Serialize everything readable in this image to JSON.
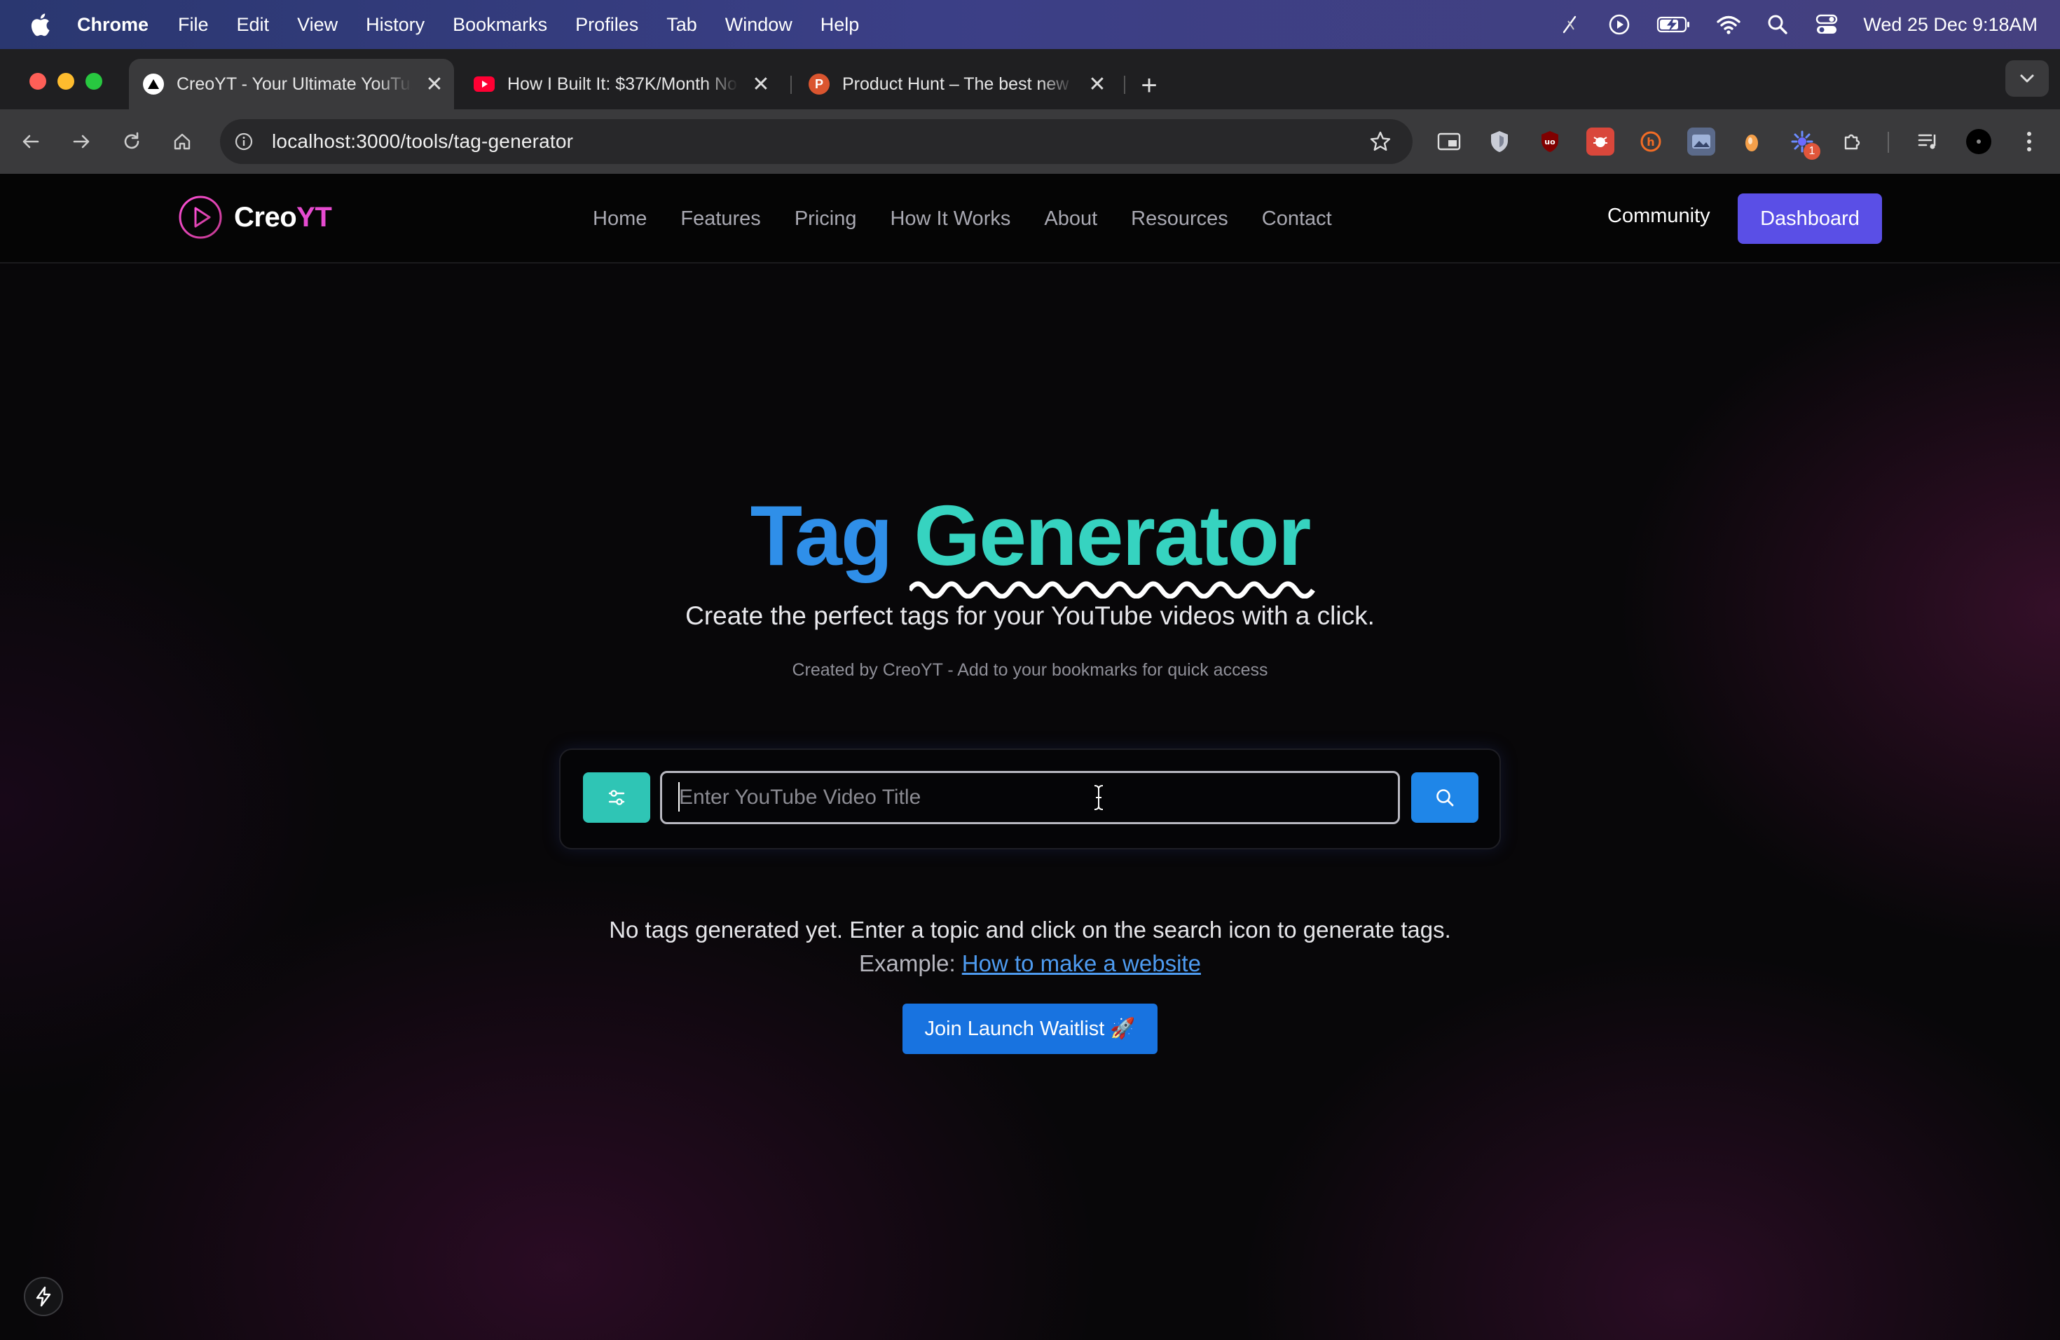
{
  "menubar": {
    "app": "Chrome",
    "items": [
      "File",
      "Edit",
      "View",
      "History",
      "Bookmarks",
      "Profiles",
      "Tab",
      "Window",
      "Help"
    ],
    "clock": "Wed 25 Dec  9:18AM",
    "icons": [
      "pen-slash-icon",
      "play-circle-icon",
      "battery-charging-icon",
      "wifi-icon",
      "spotlight-search-icon",
      "control-center-icon"
    ]
  },
  "browser": {
    "tabs": [
      {
        "title": "CreoYT - Your Ultimate YouTube",
        "icon": "triangle-favicon",
        "active": true
      },
      {
        "title": "How I Built It: $37K/Month No",
        "icon": "youtube-favicon",
        "active": false
      },
      {
        "title": "Product Hunt – The best new",
        "icon": "producthunt-favicon",
        "active": false
      }
    ],
    "new_tab": "+",
    "url": "localhost:3000/tools/tag-generator",
    "extension_badge": "1"
  },
  "site": {
    "brand_part1": "Creo",
    "brand_part2": "YT",
    "nav": [
      "Home",
      "Features",
      "Pricing",
      "How It Works",
      "About",
      "Resources",
      "Contact"
    ],
    "community": "Community",
    "dashboard": "Dashboard"
  },
  "hero": {
    "title_part1": "Tag",
    "title_part2": "Generator",
    "subtitle": "Create the perfect tags for your YouTube videos with a click.",
    "note": "Created by CreoYT - Add to your bookmarks for quick access"
  },
  "search": {
    "placeholder": "Enter YouTube Video Title",
    "value": ""
  },
  "empty_state": {
    "message": "No tags generated yet. Enter a topic and click on the search icon to generate tags.",
    "example_label": "Example: ",
    "example_link": "How to make a website"
  },
  "cta": {
    "waitlist": "Join Launch Waitlist 🚀"
  },
  "colors": {
    "accent_blue": "#2f8fe9",
    "accent_teal": "#36d3c0",
    "brand_pink": "#e64bd0",
    "dashboard_purple": "#5a4fe6",
    "button_blue": "#1873e0"
  }
}
